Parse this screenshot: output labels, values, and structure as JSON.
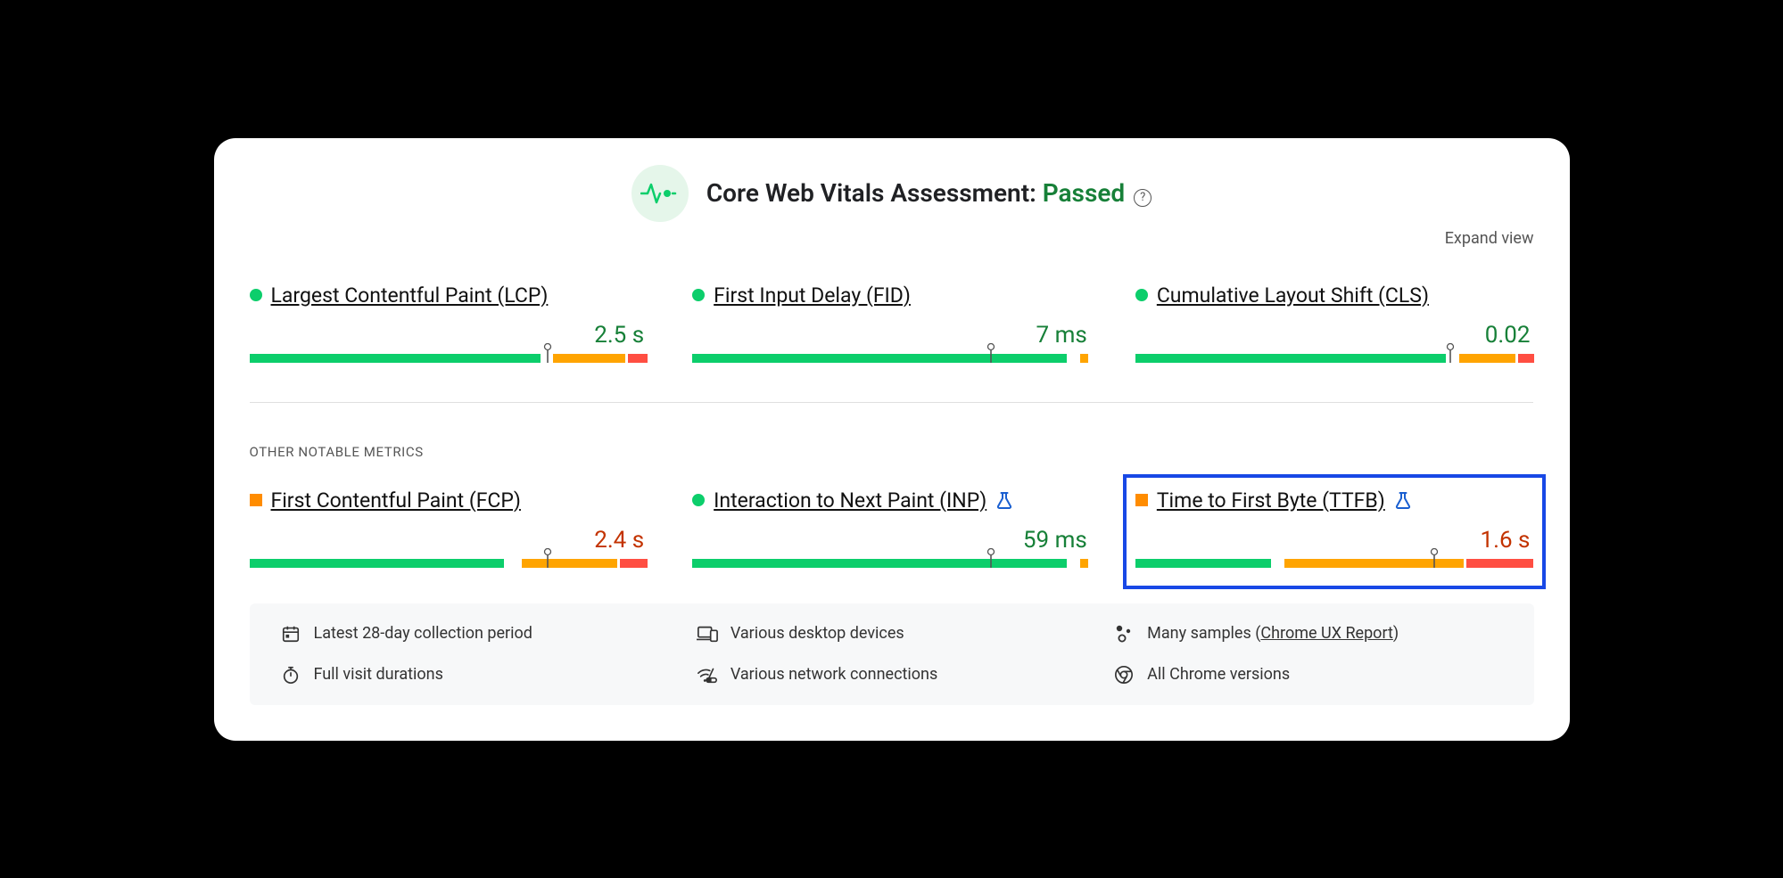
{
  "header": {
    "title_prefix": "Core Web Vitals Assessment: ",
    "status": "Passed",
    "expand_label": "Expand view"
  },
  "section_other_label": "OTHER NOTABLE METRICS",
  "metrics": {
    "lcp": {
      "name": "Largest Contentful Paint (LCP)",
      "value": "2.5 s",
      "status": "green",
      "segments": [
        73,
        2,
        18,
        5
      ],
      "marker_pct": 75
    },
    "fid": {
      "name": "First Input Delay (FID)",
      "value": "7 ms",
      "status": "green",
      "segments": [
        96,
        2,
        2,
        0
      ],
      "marker_pct": 75
    },
    "cls": {
      "name": "Cumulative Layout Shift (CLS)",
      "value": "0.02",
      "status": "green",
      "segments": [
        78,
        2,
        14,
        4
      ],
      "marker_pct": 79
    },
    "fcp": {
      "name": "First Contentful Paint (FCP)",
      "value": "2.4 s",
      "status": "orange",
      "segments": [
        64,
        3,
        24,
        7
      ],
      "marker_pct": 75
    },
    "inp": {
      "name": "Interaction to Next Paint (INP)",
      "value": "59 ms",
      "status": "green",
      "segments": [
        96,
        2,
        2,
        0
      ],
      "marker_pct": 75,
      "experimental": true
    },
    "ttfb": {
      "name": "Time to First Byte (TTFB)",
      "value": "1.6 s",
      "status": "orange",
      "segments": [
        34,
        2,
        45,
        17
      ],
      "marker_pct": 75,
      "experimental": true,
      "highlighted": true
    }
  },
  "footer": {
    "collection": "Latest 28-day collection period",
    "devices": "Various desktop devices",
    "samples_prefix": "Many samples (",
    "samples_link": "Chrome UX Report",
    "samples_suffix": ")",
    "durations": "Full visit durations",
    "network": "Various network connections",
    "chrome": "All Chrome versions"
  }
}
